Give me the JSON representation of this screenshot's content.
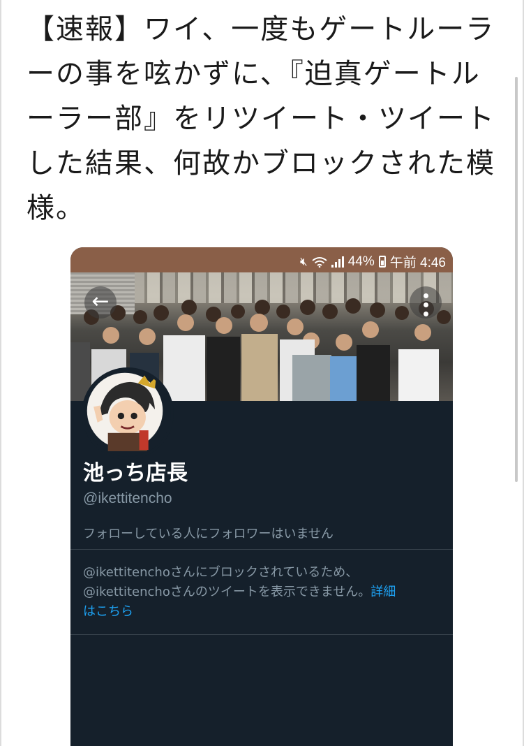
{
  "post": {
    "lines": [
      "【速報】ワイ、一度もゲートルーラ",
      "ーの事を呟かずに、『迫真ゲートル",
      "ーラー部』をリツイート・ツイート",
      "した結果、何故かブロックされた模",
      "様。"
    ]
  },
  "status_bar": {
    "battery": "44%",
    "time": "午前 4:46",
    "icons": [
      "mute-icon",
      "wifi-icon",
      "signal-icon",
      "battery-icon"
    ]
  },
  "profile": {
    "display_name": "池っち店長",
    "handle": "@ikettitencho",
    "follow_note": "フォローしている人にフォロワーはいません",
    "blocked_line1": "@ikettitenchoさんにブロックされているため、",
    "blocked_line2": "@ikettitenchoさんのツイートを表示できません。",
    "learn_more_1": "詳細",
    "learn_more_2": "はこちら"
  },
  "colors": {
    "status_bar": "#8a5f48",
    "profile_bg": "#15202b",
    "muted_text": "#8899a6",
    "link": "#1da1f2"
  }
}
